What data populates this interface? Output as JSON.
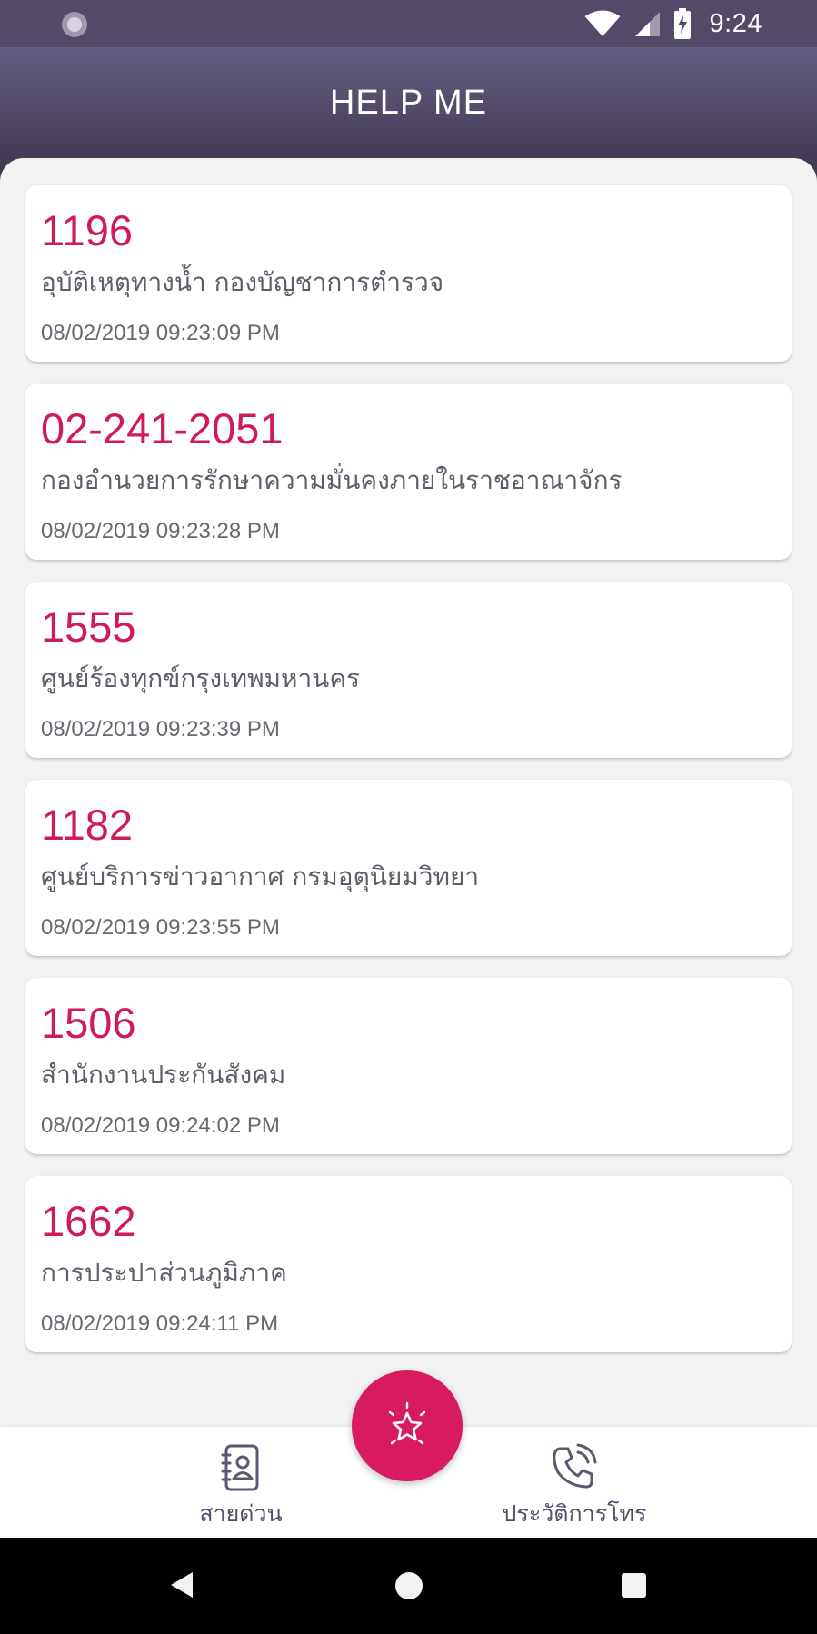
{
  "status_bar": {
    "time": "9:24",
    "icons": [
      "notification-icon",
      "wifi-icon",
      "signal-icon",
      "battery-charging-icon"
    ]
  },
  "app_bar": {
    "title": "HELP ME"
  },
  "history": [
    {
      "number": "1196",
      "name": "อุบัติเหตุทางน้ำ กองบัญชาการตำรวจ",
      "datetime": "08/02/2019 09:23:09 PM"
    },
    {
      "number": "02-241-2051",
      "name": "กองอำนวยการรักษาความมั่นคงภายในราชอาณาจักร",
      "datetime": "08/02/2019 09:23:28 PM"
    },
    {
      "number": "1555",
      "name": "ศูนย์ร้องทุกข์กรุงเทพมหานคร",
      "datetime": "08/02/2019 09:23:39 PM"
    },
    {
      "number": "1182",
      "name": "ศูนย์บริการข่าวอากาศ กรมอุตุนิยมวิทยา",
      "datetime": "08/02/2019 09:23:55 PM"
    },
    {
      "number": "1506",
      "name": "สำนักงานประกันสังคม",
      "datetime": "08/02/2019 09:24:02 PM"
    },
    {
      "number": "1662",
      "name": "การประปาส่วนภูมิภาค",
      "datetime": "08/02/2019 09:24:11 PM"
    }
  ],
  "bottom_nav": {
    "hotline_label": "สายด่วน",
    "history_label": "ประวัติการโทร",
    "hotline_icon": "contacts-book-icon",
    "history_icon": "phone-call-icon",
    "fab_icon": "star-icon"
  },
  "colors": {
    "accent": "#d81b60",
    "number_text": "#d01a5e",
    "header_top": "#655d80",
    "header_bottom": "#3c354a",
    "background": "#f2f2f2"
  }
}
